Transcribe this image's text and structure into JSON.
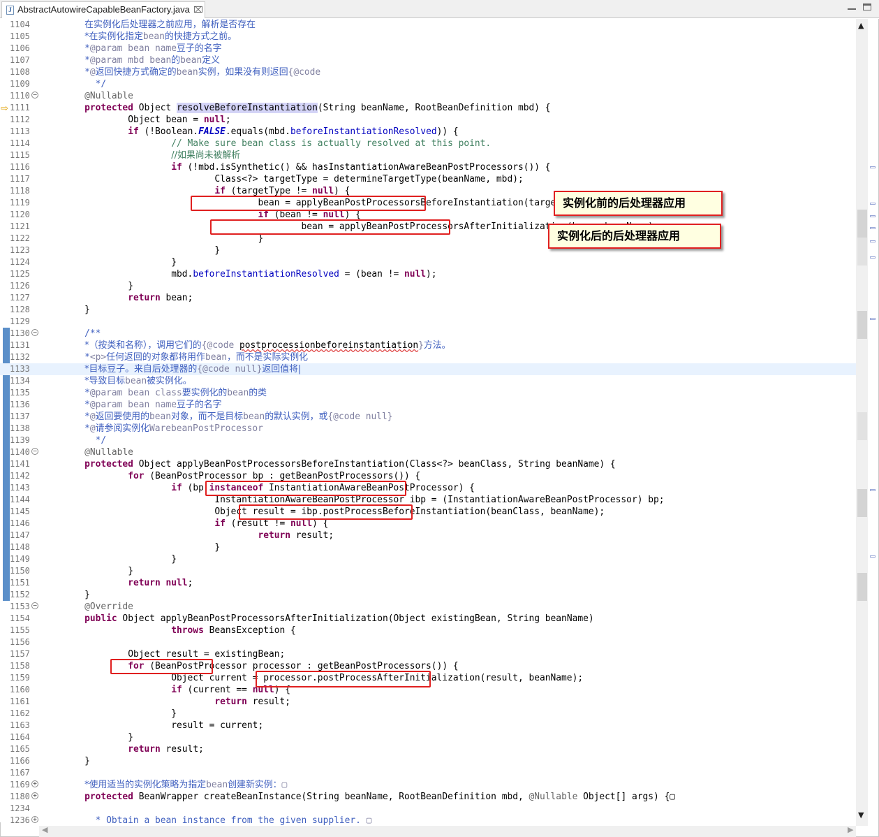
{
  "tab": {
    "filename": "AbstractAutowireCapableBeanFactory.java",
    "close": "⌧",
    "file_icon": "java-file-icon"
  },
  "window_controls": {
    "minimize": "minimize",
    "maximize": "maximize"
  },
  "annotations": {
    "before": "实例化前的后处理器应用",
    "after": "实例化后的后处理器应用"
  },
  "highlight_color": "#e02020",
  "code_lines": [
    {
      "n": "1104",
      "indent": 4,
      "seg": [
        [
          "d",
          "在实例化后处理器之前应用，解析是否存在"
        ]
      ]
    },
    {
      "n": "1105",
      "indent": 4,
      "seg": [
        [
          "d",
          "*在实例化指定"
        ],
        [
          "t",
          "bean"
        ],
        [
          "d",
          "的快捷方式之前。"
        ]
      ]
    },
    {
      "n": "1106",
      "indent": 4,
      "seg": [
        [
          "d",
          "*"
        ],
        [
          "t",
          "@param bean name"
        ],
        [
          "d",
          "豆子的名字"
        ]
      ]
    },
    {
      "n": "1107",
      "indent": 4,
      "seg": [
        [
          "d",
          "*"
        ],
        [
          "t",
          "@param mbd bean"
        ],
        [
          "d",
          "的"
        ],
        [
          "t",
          "bean"
        ],
        [
          "d",
          "定义"
        ]
      ]
    },
    {
      "n": "1108",
      "indent": 4,
      "seg": [
        [
          "d",
          "*"
        ],
        [
          "t",
          "@"
        ],
        [
          "d",
          "返回快捷方式确定的"
        ],
        [
          "t",
          "bean"
        ],
        [
          "d",
          "实例，如果没有则返回"
        ],
        [
          "t",
          "{@code"
        ]
      ]
    },
    {
      "n": "1109",
      "indent": 5,
      "seg": [
        [
          "d",
          "*/"
        ]
      ]
    },
    {
      "n": "1110",
      "indent": 4,
      "fold": "⊖",
      "seg": [
        [
          "a",
          "@Nullable"
        ]
      ]
    },
    {
      "n": "1111",
      "indent": 4,
      "seg": [
        [
          "k",
          "protected"
        ],
        [
          "",
          " Object "
        ],
        [
          "hl",
          "resolveBeforeInstantiation"
        ],
        [
          "",
          "(String beanName, RootBeanDefinition mbd) {"
        ]
      ]
    },
    {
      "n": "1112",
      "indent": 8,
      "seg": [
        [
          "",
          "Object bean = "
        ],
        [
          "k",
          "null"
        ],
        [
          "",
          ";"
        ]
      ]
    },
    {
      "n": "1113",
      "indent": 8,
      "seg": [
        [
          "k",
          "if"
        ],
        [
          "",
          " (!Boolean."
        ],
        [
          "fi",
          "FALSE"
        ],
        [
          "",
          ".equals(mbd."
        ],
        [
          "f",
          "beforeInstantiationResolved"
        ],
        [
          "",
          ")) {"
        ]
      ]
    },
    {
      "n": "1114",
      "indent": 12,
      "seg": [
        [
          "c",
          "// Make sure bean class is actually resolved at this point."
        ]
      ]
    },
    {
      "n": "1115",
      "indent": 12,
      "seg": [
        [
          "c",
          "//如果尚未被解析"
        ]
      ]
    },
    {
      "n": "1116",
      "indent": 12,
      "seg": [
        [
          "k",
          "if"
        ],
        [
          "",
          " (!mbd.isSynthetic() && hasInstantiationAwareBeanPostProcessors()) {"
        ]
      ]
    },
    {
      "n": "1117",
      "indent": 16,
      "seg": [
        [
          "",
          "Class<?> targetType = determineTargetType(beanName, mbd);"
        ]
      ]
    },
    {
      "n": "1118",
      "indent": 16,
      "seg": [
        [
          "k",
          "if"
        ],
        [
          "",
          " (targetType != "
        ],
        [
          "k",
          "null"
        ],
        [
          "",
          ") {"
        ]
      ]
    },
    {
      "n": "1119",
      "indent": 20,
      "seg": [
        [
          "",
          "bean = applyBeanPostProcessorsBeforeInstantiation(targetType, beanName);"
        ]
      ]
    },
    {
      "n": "1120",
      "indent": 20,
      "seg": [
        [
          "k",
          "if"
        ],
        [
          "",
          " (bean != "
        ],
        [
          "k",
          "null"
        ],
        [
          "",
          ") {"
        ]
      ]
    },
    {
      "n": "1121",
      "indent": 24,
      "seg": [
        [
          "",
          "bean = applyBeanPostProcessorsAfterInitialization(bean, beanName);"
        ]
      ]
    },
    {
      "n": "1122",
      "indent": 20,
      "seg": [
        [
          "",
          "}"
        ]
      ]
    },
    {
      "n": "1123",
      "indent": 16,
      "seg": [
        [
          "",
          "}"
        ]
      ]
    },
    {
      "n": "1124",
      "indent": 12,
      "seg": [
        [
          "",
          "}"
        ]
      ]
    },
    {
      "n": "1125",
      "indent": 12,
      "seg": [
        [
          "",
          "mbd."
        ],
        [
          "f",
          "beforeInstantiationResolved"
        ],
        [
          "",
          " = (bean != "
        ],
        [
          "k",
          "null"
        ],
        [
          "",
          ");"
        ]
      ]
    },
    {
      "n": "1126",
      "indent": 8,
      "seg": [
        [
          "",
          "}"
        ]
      ]
    },
    {
      "n": "1127",
      "indent": 8,
      "seg": [
        [
          "k",
          "return"
        ],
        [
          "",
          " bean;"
        ]
      ]
    },
    {
      "n": "1128",
      "indent": 4,
      "seg": [
        [
          "",
          "}"
        ]
      ]
    },
    {
      "n": "1129",
      "indent": 0,
      "seg": []
    },
    {
      "n": "1130",
      "indent": 4,
      "fold": "⊖",
      "seg": [
        [
          "d",
          "/**"
        ]
      ]
    },
    {
      "n": "1131",
      "indent": 4,
      "seg": [
        [
          "d",
          "*（按类和名称），调用它们的"
        ],
        [
          "t",
          "{@code "
        ],
        [
          "sq",
          "postprocessionbeforeinstantiation"
        ],
        [
          "t",
          "}"
        ],
        [
          "d",
          "方法。"
        ]
      ]
    },
    {
      "n": "1132",
      "indent": 4,
      "seg": [
        [
          "d",
          "*"
        ],
        [
          "t",
          "<p>"
        ],
        [
          "d",
          "任何返回的对象都将用作"
        ],
        [
          "t",
          "bean"
        ],
        [
          "d",
          "，而不是实际实例化"
        ]
      ]
    },
    {
      "n": "1133",
      "indent": 4,
      "cur": true,
      "seg": [
        [
          "d",
          "*目标豆子。来自后处理器的"
        ],
        [
          "t",
          "{@code null}"
        ],
        [
          "d",
          "返回值将|"
        ]
      ]
    },
    {
      "n": "1134",
      "indent": 4,
      "seg": [
        [
          "d",
          "*导致目标"
        ],
        [
          "t",
          "bean"
        ],
        [
          "d",
          "被实例化。"
        ]
      ]
    },
    {
      "n": "1135",
      "indent": 4,
      "seg": [
        [
          "d",
          "*"
        ],
        [
          "t",
          "@param bean class"
        ],
        [
          "d",
          "要实例化的"
        ],
        [
          "t",
          "bean"
        ],
        [
          "d",
          "的类"
        ]
      ]
    },
    {
      "n": "1136",
      "indent": 4,
      "seg": [
        [
          "d",
          "*"
        ],
        [
          "t",
          "@param bean name"
        ],
        [
          "d",
          "豆子的名字"
        ]
      ]
    },
    {
      "n": "1137",
      "indent": 4,
      "seg": [
        [
          "d",
          "*"
        ],
        [
          "t",
          "@"
        ],
        [
          "d",
          "返回要使用的"
        ],
        [
          "t",
          "bean"
        ],
        [
          "d",
          "对象，而不是目标"
        ],
        [
          "t",
          "bean"
        ],
        [
          "d",
          "的默认实例，或"
        ],
        [
          "t",
          "{@code null}"
        ]
      ]
    },
    {
      "n": "1138",
      "indent": 4,
      "seg": [
        [
          "d",
          "*"
        ],
        [
          "t",
          "@"
        ],
        [
          "d",
          "请参阅实例化"
        ],
        [
          "t",
          "WarebeanPostProcessor"
        ]
      ]
    },
    {
      "n": "1139",
      "indent": 5,
      "seg": [
        [
          "d",
          "*/"
        ]
      ]
    },
    {
      "n": "1140",
      "indent": 4,
      "fold": "⊖",
      "seg": [
        [
          "a",
          "@Nullable"
        ]
      ]
    },
    {
      "n": "1141",
      "indent": 4,
      "seg": [
        [
          "k",
          "protected"
        ],
        [
          "",
          " Object applyBeanPostProcessorsBeforeInstantiation(Class<?> beanClass, String beanName) {"
        ]
      ]
    },
    {
      "n": "1142",
      "indent": 8,
      "seg": [
        [
          "k",
          "for"
        ],
        [
          "",
          " (BeanPostProcessor bp : getBeanPostProcessors()) {"
        ]
      ]
    },
    {
      "n": "1143",
      "indent": 12,
      "seg": [
        [
          "k",
          "if"
        ],
        [
          "",
          " (bp "
        ],
        [
          "k",
          "instanceof"
        ],
        [
          "",
          " InstantiationAwareBeanPostProcessor) {"
        ]
      ]
    },
    {
      "n": "1144",
      "indent": 16,
      "seg": [
        [
          "",
          "InstantiationAwareBeanPostProcessor ibp = (InstantiationAwareBeanPostProcessor) bp;"
        ]
      ]
    },
    {
      "n": "1145",
      "indent": 16,
      "seg": [
        [
          "",
          "Object result = ibp.postProcessBeforeInstantiation(beanClass, beanName);"
        ]
      ]
    },
    {
      "n": "1146",
      "indent": 16,
      "seg": [
        [
          "k",
          "if"
        ],
        [
          "",
          " (result != "
        ],
        [
          "k",
          "null"
        ],
        [
          "",
          ") {"
        ]
      ]
    },
    {
      "n": "1147",
      "indent": 20,
      "seg": [
        [
          "k",
          "return"
        ],
        [
          "",
          " result;"
        ]
      ]
    },
    {
      "n": "1148",
      "indent": 16,
      "seg": [
        [
          "",
          "}"
        ]
      ]
    },
    {
      "n": "1149",
      "indent": 12,
      "seg": [
        [
          "",
          "}"
        ]
      ]
    },
    {
      "n": "1150",
      "indent": 8,
      "seg": [
        [
          "",
          "}"
        ]
      ]
    },
    {
      "n": "1151",
      "indent": 8,
      "seg": [
        [
          "k",
          "return"
        ],
        [
          "",
          " "
        ],
        [
          "k",
          "null"
        ],
        [
          "",
          ";"
        ]
      ]
    },
    {
      "n": "1152",
      "indent": 4,
      "seg": [
        [
          "",
          "}"
        ]
      ]
    },
    {
      "n": "1153",
      "indent": 4,
      "fold": "⊖",
      "seg": [
        [
          "a",
          "@Override"
        ]
      ]
    },
    {
      "n": "1154",
      "indent": 4,
      "seg": [
        [
          "k",
          "public"
        ],
        [
          "",
          " Object applyBeanPostProcessorsAfterInitialization(Object existingBean, String beanName)"
        ]
      ]
    },
    {
      "n": "1155",
      "indent": 12,
      "seg": [
        [
          "k",
          "throws"
        ],
        [
          "",
          " BeansException {"
        ]
      ]
    },
    {
      "n": "1156",
      "indent": 0,
      "seg": []
    },
    {
      "n": "1157",
      "indent": 8,
      "seg": [
        [
          "",
          "Object result = existingBean;"
        ]
      ]
    },
    {
      "n": "1158",
      "indent": 8,
      "seg": [
        [
          "k",
          "for"
        ],
        [
          "",
          " (BeanPostProcessor processor : getBeanPostProcessors()) {"
        ]
      ]
    },
    {
      "n": "1159",
      "indent": 12,
      "seg": [
        [
          "",
          "Object current = processor.postProcessAfterInitialization(result, beanName);"
        ]
      ]
    },
    {
      "n": "1160",
      "indent": 12,
      "seg": [
        [
          "k",
          "if"
        ],
        [
          "",
          " (current == "
        ],
        [
          "k",
          "null"
        ],
        [
          "",
          ") {"
        ]
      ]
    },
    {
      "n": "1161",
      "indent": 16,
      "seg": [
        [
          "k",
          "return"
        ],
        [
          "",
          " result;"
        ]
      ]
    },
    {
      "n": "1162",
      "indent": 12,
      "seg": [
        [
          "",
          "}"
        ]
      ]
    },
    {
      "n": "1163",
      "indent": 12,
      "seg": [
        [
          "",
          "result = current;"
        ]
      ]
    },
    {
      "n": "1164",
      "indent": 8,
      "seg": [
        [
          "",
          "}"
        ]
      ]
    },
    {
      "n": "1165",
      "indent": 8,
      "seg": [
        [
          "k",
          "return"
        ],
        [
          "",
          " result;"
        ]
      ]
    },
    {
      "n": "1166",
      "indent": 4,
      "seg": [
        [
          "",
          "}"
        ]
      ]
    },
    {
      "n": "1167",
      "indent": 0,
      "seg": []
    },
    {
      "n": "1169",
      "indent": 4,
      "fold": "⊕",
      "seg": [
        [
          "d",
          "*使用适当的实例化策略为指定"
        ],
        [
          "t",
          "bean"
        ],
        [
          "d",
          "创建新实例："
        ],
        [
          "t",
          "▢"
        ]
      ]
    },
    {
      "n": "1180",
      "indent": 4,
      "fold": "⊕",
      "seg": [
        [
          "k",
          "protected"
        ],
        [
          "",
          " BeanWrapper createBeanInstance(String beanName, RootBeanDefinition mbd, "
        ],
        [
          "a",
          "@Nullable"
        ],
        [
          "",
          " Object[] args) {▢"
        ]
      ]
    },
    {
      "n": "1234",
      "indent": 0,
      "seg": []
    },
    {
      "n": "1236",
      "indent": 5,
      "fold": "⊕",
      "seg": [
        [
          "d",
          "* Obtain a bean instance from the given supplier. "
        ],
        [
          "t",
          "▢"
        ]
      ]
    }
  ]
}
